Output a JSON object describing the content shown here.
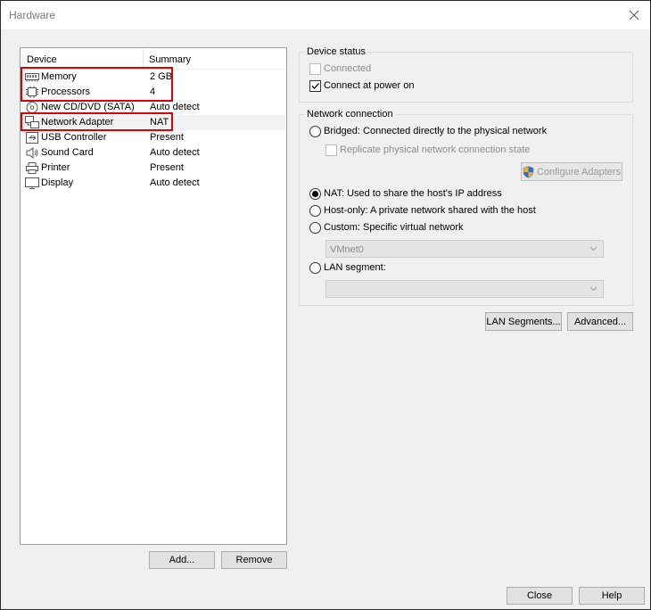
{
  "window": {
    "title": "Hardware"
  },
  "device_list": {
    "columns": {
      "device": "Device",
      "summary": "Summary"
    },
    "items": [
      {
        "name": "Memory",
        "summary": "2 GB",
        "icon": "memory-icon"
      },
      {
        "name": "Processors",
        "summary": "4",
        "icon": "processor-icon"
      },
      {
        "name": "New CD/DVD (SATA)",
        "summary": "Auto detect",
        "icon": "cd-dvd-icon"
      },
      {
        "name": "Network Adapter",
        "summary": "NAT",
        "icon": "network-adapter-icon"
      },
      {
        "name": "USB Controller",
        "summary": "Present",
        "icon": "usb-icon"
      },
      {
        "name": "Sound Card",
        "summary": "Auto detect",
        "icon": "speaker-icon"
      },
      {
        "name": "Printer",
        "summary": "Present",
        "icon": "printer-icon"
      },
      {
        "name": "Display",
        "summary": "Auto detect",
        "icon": "monitor-icon"
      }
    ],
    "add_label": "Add...",
    "remove_label": "Remove"
  },
  "device_status": {
    "title": "Device status",
    "connected_label": "Connected",
    "connected_checked": false,
    "connect_at_power_on_label": "Connect at power on",
    "connect_at_power_on_checked": true
  },
  "network_connection": {
    "title": "Network connection",
    "bridged_label": "Bridged: Connected directly to the physical network",
    "replicate_label": "Replicate physical network connection state",
    "configure_adapters_label": "Configure Adapters",
    "nat_label": "NAT: Used to share the host's IP address",
    "host_only_label": "Host-only: A private network shared with the host",
    "custom_label": "Custom: Specific virtual network",
    "custom_select_value": "VMnet0",
    "lan_segment_label": "LAN segment:",
    "lan_segment_select_value": "",
    "selected": "nat"
  },
  "network_buttons": {
    "lan_segments_label": "LAN Segments...",
    "advanced_label": "Advanced..."
  },
  "footer": {
    "close_label": "Close",
    "help_label": "Help"
  },
  "colors": {
    "highlight": "#e00000",
    "selected_row": "#f2f2f2",
    "shield_blue": "#2f6fc9",
    "shield_gold": "#e2b33a"
  }
}
